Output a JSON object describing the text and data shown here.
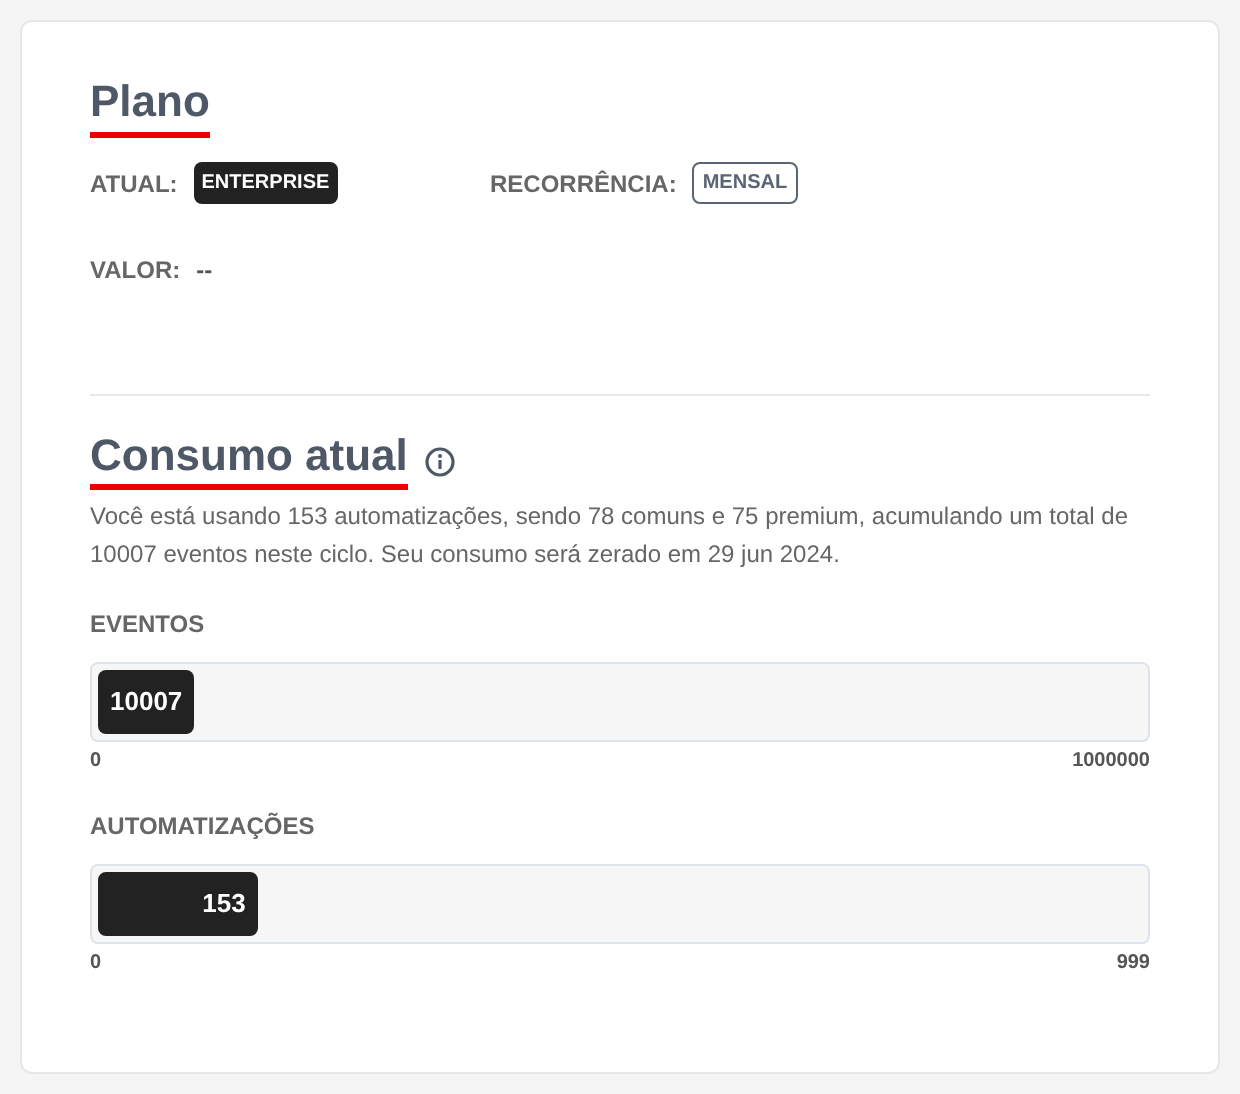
{
  "plan": {
    "title": "Plano",
    "fields": [
      {
        "label": "ATUAL:",
        "value": "ENTERPRISE",
        "kind": "solid"
      },
      {
        "label": "RECORRÊNCIA:",
        "value": "MENSAL",
        "kind": "outline"
      },
      {
        "label": "VALOR:",
        "value": "--",
        "kind": "plain"
      }
    ]
  },
  "usage": {
    "title": "Consumo atual",
    "description": "Você está usando 153 automatizações, sendo 78 comuns e 75 premium, acumulando um total de 10007 eventos neste ciclo. Seu consumo será zerado em 29 jun 2024.",
    "meters": [
      {
        "label": "EVENTOS",
        "value": "10007",
        "level": 0.01,
        "min": "0",
        "max": "1000000"
      },
      {
        "label": "AUTOMATIZAÇÕES",
        "value": "153",
        "level": 0.153,
        "min": "0",
        "max": "999"
      }
    ]
  }
}
